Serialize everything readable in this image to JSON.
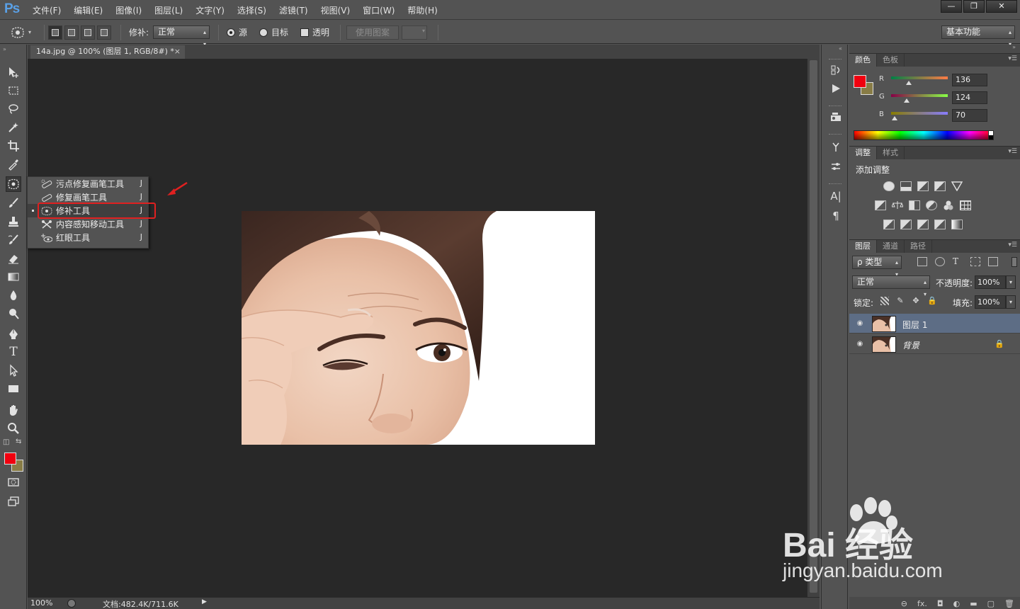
{
  "app": {
    "logo": "Ps",
    "menu": [
      "文件(F)",
      "编辑(E)",
      "图像(I)",
      "图层(L)",
      "文字(Y)",
      "选择(S)",
      "滤镜(T)",
      "视图(V)",
      "窗口(W)",
      "帮助(H)"
    ],
    "window_controls": [
      "—",
      "❐",
      "✕"
    ]
  },
  "options_bar": {
    "patch_label": "修补:",
    "patch_mode": "正常",
    "source_label": "源",
    "target_label": "目标",
    "transparent_label": "透明",
    "use_pattern_label": "使用图案",
    "workspace": "基本功能"
  },
  "document": {
    "tab_title": "14a.jpg @ 100% (图层 1, RGB/8#) *",
    "tab_close": "×",
    "zoom": "100%",
    "doc_size": "文档:482.4K/711.6K"
  },
  "flyout_menu": {
    "items": [
      {
        "label": "污点修复画笔工具",
        "key": "J",
        "icon": "spot-healing-brush-icon"
      },
      {
        "label": "修复画笔工具",
        "key": "J",
        "icon": "healing-brush-icon"
      },
      {
        "label": "修补工具",
        "key": "J",
        "icon": "patch-tool-icon",
        "selected": true
      },
      {
        "label": "内容感知移动工具",
        "key": "J",
        "icon": "content-aware-move-icon"
      },
      {
        "label": "红眼工具",
        "key": "J",
        "icon": "red-eye-icon"
      }
    ]
  },
  "colors": {
    "foreground": "#f0000f",
    "background": "#887c46",
    "highlight": "#e02020"
  },
  "color_panel": {
    "tabs": [
      "颜色",
      "色板"
    ],
    "r_label": "R",
    "r_value": "136",
    "g_label": "G",
    "g_value": "124",
    "b_label": "B",
    "b_value": "70"
  },
  "adjustments_panel": {
    "tabs": [
      "调整",
      "样式"
    ],
    "title": "添加调整"
  },
  "layers_panel": {
    "tabs": [
      "图层",
      "通道",
      "路径"
    ],
    "filter_label": "ρ 类型",
    "blend_mode": "正常",
    "opacity_label": "不透明度:",
    "opacity_value": "100%",
    "lock_label": "锁定:",
    "fill_label": "填充:",
    "fill_value": "100%",
    "layers": [
      {
        "name": "图层 1",
        "selected": true
      },
      {
        "name": "背景",
        "locked": true
      }
    ],
    "footer_icons": [
      "⊖",
      "fx.",
      "◘",
      "◐",
      "▬",
      "▢",
      "🗑"
    ]
  },
  "watermark": {
    "logo": "Bai 经验",
    "url": "jingyan.baidu.com"
  }
}
